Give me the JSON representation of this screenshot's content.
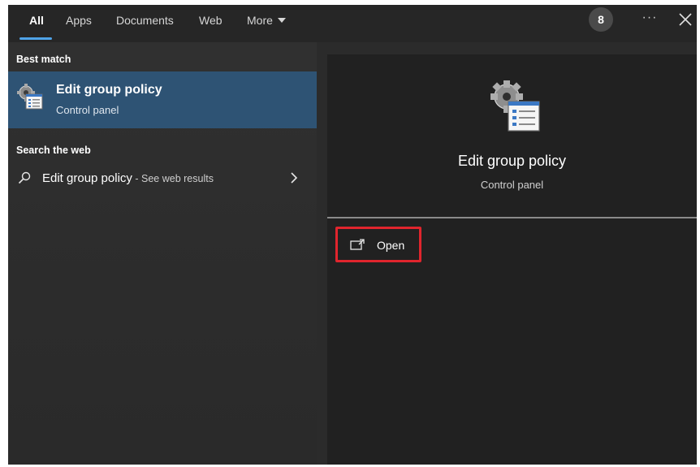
{
  "tabs": [
    {
      "label": "All",
      "active": true
    },
    {
      "label": "Apps"
    },
    {
      "label": "Documents"
    },
    {
      "label": "Web"
    },
    {
      "label": "More"
    }
  ],
  "header": {
    "badge_count": "8",
    "more_options_label": "···"
  },
  "left": {
    "best_match_label": "Best match",
    "best_match": {
      "title": "Edit group policy",
      "subtitle": "Control panel",
      "icon": "group-policy-icon"
    },
    "search_web_label": "Search the web",
    "web_result": {
      "query": "Edit group policy",
      "suffix": " - See web results",
      "icon": "search-icon"
    }
  },
  "preview": {
    "title": "Edit group policy",
    "subtitle": "Control panel",
    "icon": "group-policy-icon",
    "actions": [
      {
        "label": "Open",
        "icon": "open-icon",
        "highlighted": true
      }
    ]
  },
  "colors": {
    "accent": "#4fa3e8",
    "selection": "#2e5374",
    "highlight_box": "#e0252d"
  }
}
